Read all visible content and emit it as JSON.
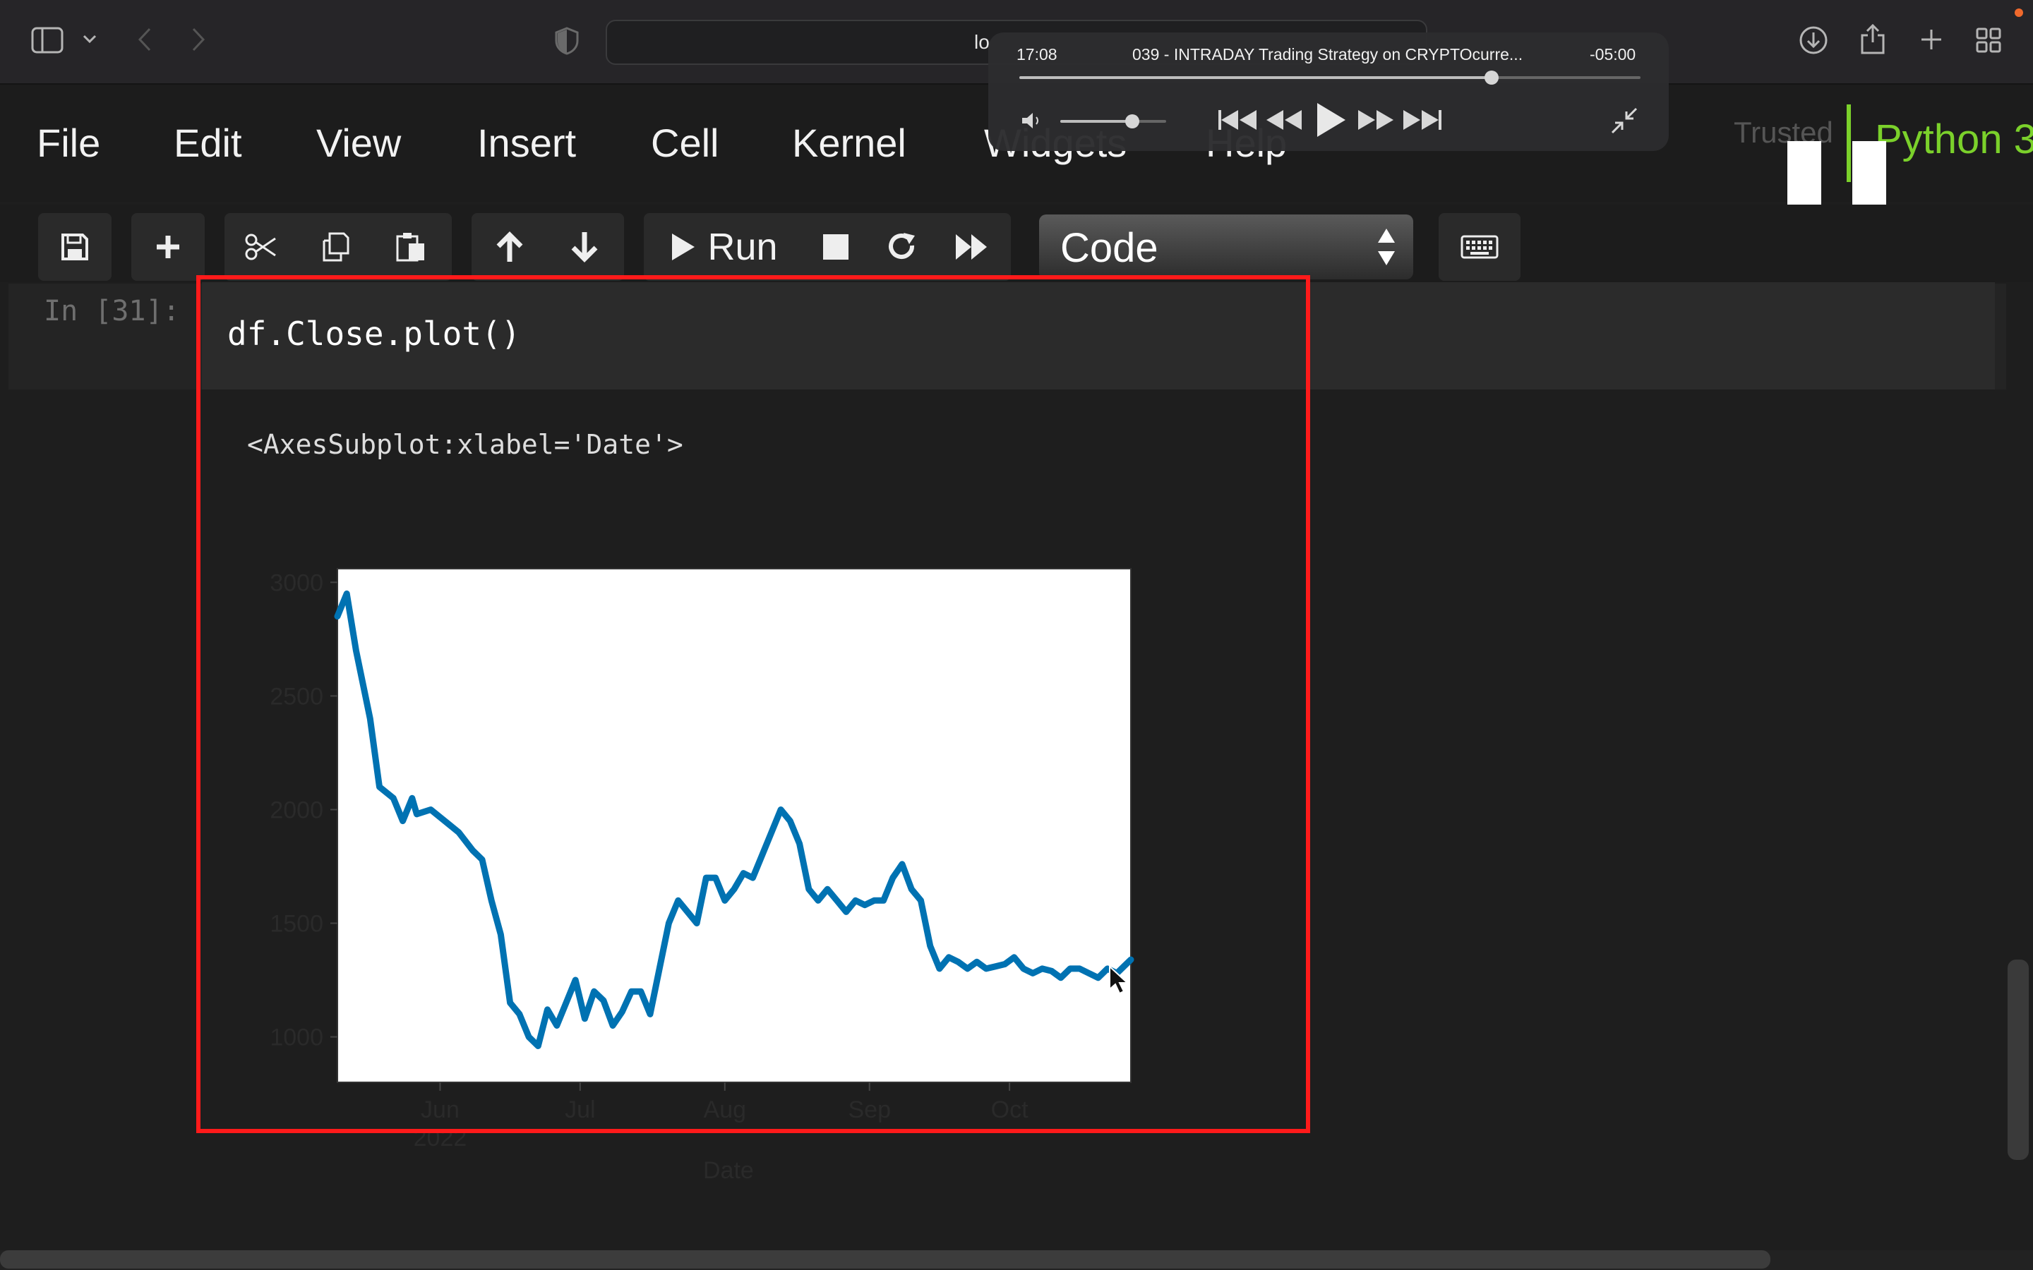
{
  "browser": {
    "address_text": "lo",
    "icons": [
      "sidebar-icon",
      "chevron-down-icon",
      "back-icon",
      "forward-icon",
      "shield-icon",
      "download-icon",
      "share-icon",
      "new-tab-icon",
      "tab-overview-icon"
    ]
  },
  "menubar": {
    "items": [
      "File",
      "Edit",
      "View",
      "Insert",
      "Cell",
      "Kernel",
      "Widgets",
      "Help"
    ],
    "trusted": "Trusted",
    "kernel": "Python 3"
  },
  "toolbar": {
    "run_label": "Run",
    "cell_type": "Code"
  },
  "cell": {
    "prompt": "In [31]:",
    "code": "df.Close.plot()",
    "output": "<AxesSubplot:xlabel='Date'>"
  },
  "video_player": {
    "elapsed": "17:08",
    "title": "039 - INTRADAY Trading Strategy on CRYPTOcurre...",
    "remaining": "-05:00",
    "progress": 0.76,
    "volume": 0.68
  },
  "chart_data": {
    "type": "line",
    "title": "",
    "xlabel": "Date",
    "ylabel": "",
    "x_tick_labels": [
      "Jun\n2022",
      "Jul",
      "Aug",
      "Sep",
      "Oct"
    ],
    "y_tick_labels": [
      "1000",
      "1500",
      "2000",
      "2500",
      "3000"
    ],
    "ylim": [
      800,
      3060
    ],
    "xlim": [
      "2022-05-10",
      "2022-10-27"
    ],
    "grid": false,
    "series": [
      {
        "color": "#0072b2",
        "x": [
          "2022-05-10",
          "2022-05-12",
          "2022-05-14",
          "2022-05-17",
          "2022-05-19",
          "2022-05-22",
          "2022-05-24",
          "2022-05-26",
          "2022-05-27",
          "2022-05-30",
          "2022-06-02",
          "2022-06-05",
          "2022-06-08",
          "2022-06-10",
          "2022-06-12",
          "2022-06-14",
          "2022-06-16",
          "2022-06-18",
          "2022-06-20",
          "2022-06-22",
          "2022-06-24",
          "2022-06-26",
          "2022-06-28",
          "2022-06-30",
          "2022-07-02",
          "2022-07-04",
          "2022-07-06",
          "2022-07-08",
          "2022-07-10",
          "2022-07-12",
          "2022-07-14",
          "2022-07-16",
          "2022-07-18",
          "2022-07-20",
          "2022-07-22",
          "2022-07-24",
          "2022-07-26",
          "2022-07-28",
          "2022-07-30",
          "2022-08-01",
          "2022-08-03",
          "2022-08-05",
          "2022-08-07",
          "2022-08-09",
          "2022-08-11",
          "2022-08-13",
          "2022-08-15",
          "2022-08-17",
          "2022-08-19",
          "2022-08-21",
          "2022-08-23",
          "2022-08-25",
          "2022-08-27",
          "2022-08-29",
          "2022-08-31",
          "2022-09-02",
          "2022-09-04",
          "2022-09-06",
          "2022-09-08",
          "2022-09-10",
          "2022-09-12",
          "2022-09-14",
          "2022-09-16",
          "2022-09-18",
          "2022-09-20",
          "2022-09-22",
          "2022-09-24",
          "2022-09-26",
          "2022-09-28",
          "2022-09-30",
          "2022-10-02",
          "2022-10-04",
          "2022-10-06",
          "2022-10-08",
          "2022-10-10",
          "2022-10-12",
          "2022-10-14",
          "2022-10-16",
          "2022-10-18",
          "2022-10-20",
          "2022-10-22",
          "2022-10-24",
          "2022-10-26",
          "2022-10-27"
        ],
        "values": [
          2850,
          2950,
          2700,
          2400,
          2100,
          2050,
          1950,
          2050,
          1980,
          2000,
          1950,
          1900,
          1820,
          1780,
          1600,
          1450,
          1150,
          1100,
          1000,
          960,
          1120,
          1050,
          1150,
          1250,
          1080,
          1200,
          1160,
          1050,
          1110,
          1200,
          1200,
          1100,
          1300,
          1500,
          1600,
          1550,
          1500,
          1700,
          1700,
          1600,
          1650,
          1720,
          1700,
          1800,
          1900,
          2000,
          1950,
          1850,
          1650,
          1600,
          1650,
          1600,
          1550,
          1600,
          1580,
          1600,
          1600,
          1700,
          1760,
          1650,
          1600,
          1400,
          1300,
          1350,
          1330,
          1300,
          1330,
          1300,
          1310,
          1320,
          1350,
          1300,
          1280,
          1300,
          1290,
          1260,
          1300,
          1300,
          1280,
          1260,
          1300,
          1280,
          1320,
          1340
        ]
      }
    ]
  }
}
